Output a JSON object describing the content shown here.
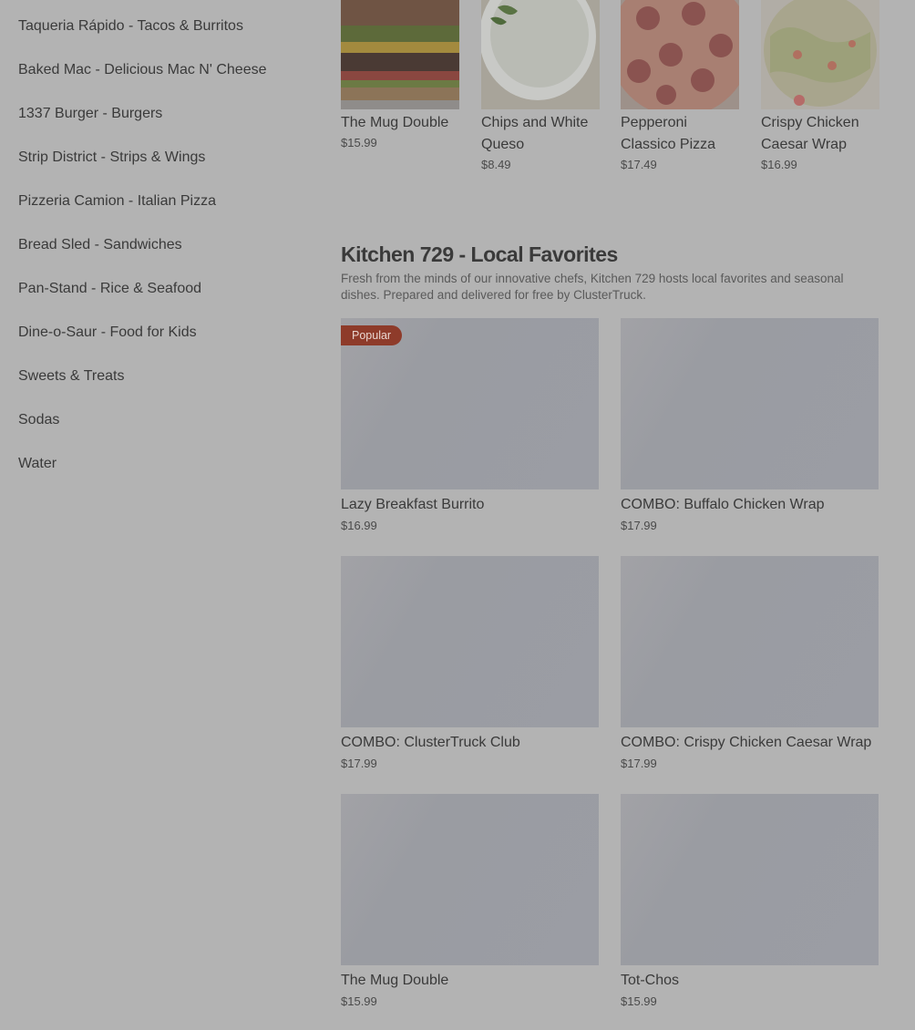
{
  "sidebar": {
    "items": [
      {
        "label": "Taqueria Rápido - Tacos & Burritos"
      },
      {
        "label": "Baked Mac - Delicious Mac N' Cheese"
      },
      {
        "label": "1337 Burger - Burgers"
      },
      {
        "label": "Strip District - Strips & Wings"
      },
      {
        "label": "Pizzeria Camion - Italian Pizza"
      },
      {
        "label": "Bread Sled - Sandwiches"
      },
      {
        "label": "Pan-Stand - Rice & Seafood"
      },
      {
        "label": "Dine-o-Saur - Food for Kids"
      },
      {
        "label": "Sweets & Treats"
      },
      {
        "label": "Sodas"
      },
      {
        "label": "Water"
      }
    ]
  },
  "top_items": [
    {
      "name": "The Mug Double",
      "price": "$15.99"
    },
    {
      "name": "Chips and White Queso",
      "price": "$8.49"
    },
    {
      "name": "Pepperoni Classico Pizza",
      "price": "$17.49"
    },
    {
      "name": "Crispy Chicken Caesar Wrap",
      "price": "$16.99"
    }
  ],
  "section": {
    "title": "Kitchen 729 - Local Favorites",
    "description": "Fresh from the minds of our innovative chefs, Kitchen 729 hosts local favorites and seasonal dishes. Prepared and delivered for free by ClusterTruck.",
    "badge": "Popular",
    "items": [
      {
        "name": "Lazy Breakfast Burrito",
        "price": "$16.99"
      },
      {
        "name": "COMBO: Buffalo Chicken Wrap",
        "price": "$17.99"
      },
      {
        "name": "COMBO: ClusterTruck Club",
        "price": "$17.99"
      },
      {
        "name": "COMBO: Crispy Chicken Caesar Wrap",
        "price": "$17.99"
      },
      {
        "name": "The Mug Double",
        "price": "$15.99"
      },
      {
        "name": "Tot-Chos",
        "price": "$15.99"
      }
    ]
  },
  "colors": {
    "overlay_background": "#b3b3b3",
    "badge_background": "#8e3b2a"
  }
}
